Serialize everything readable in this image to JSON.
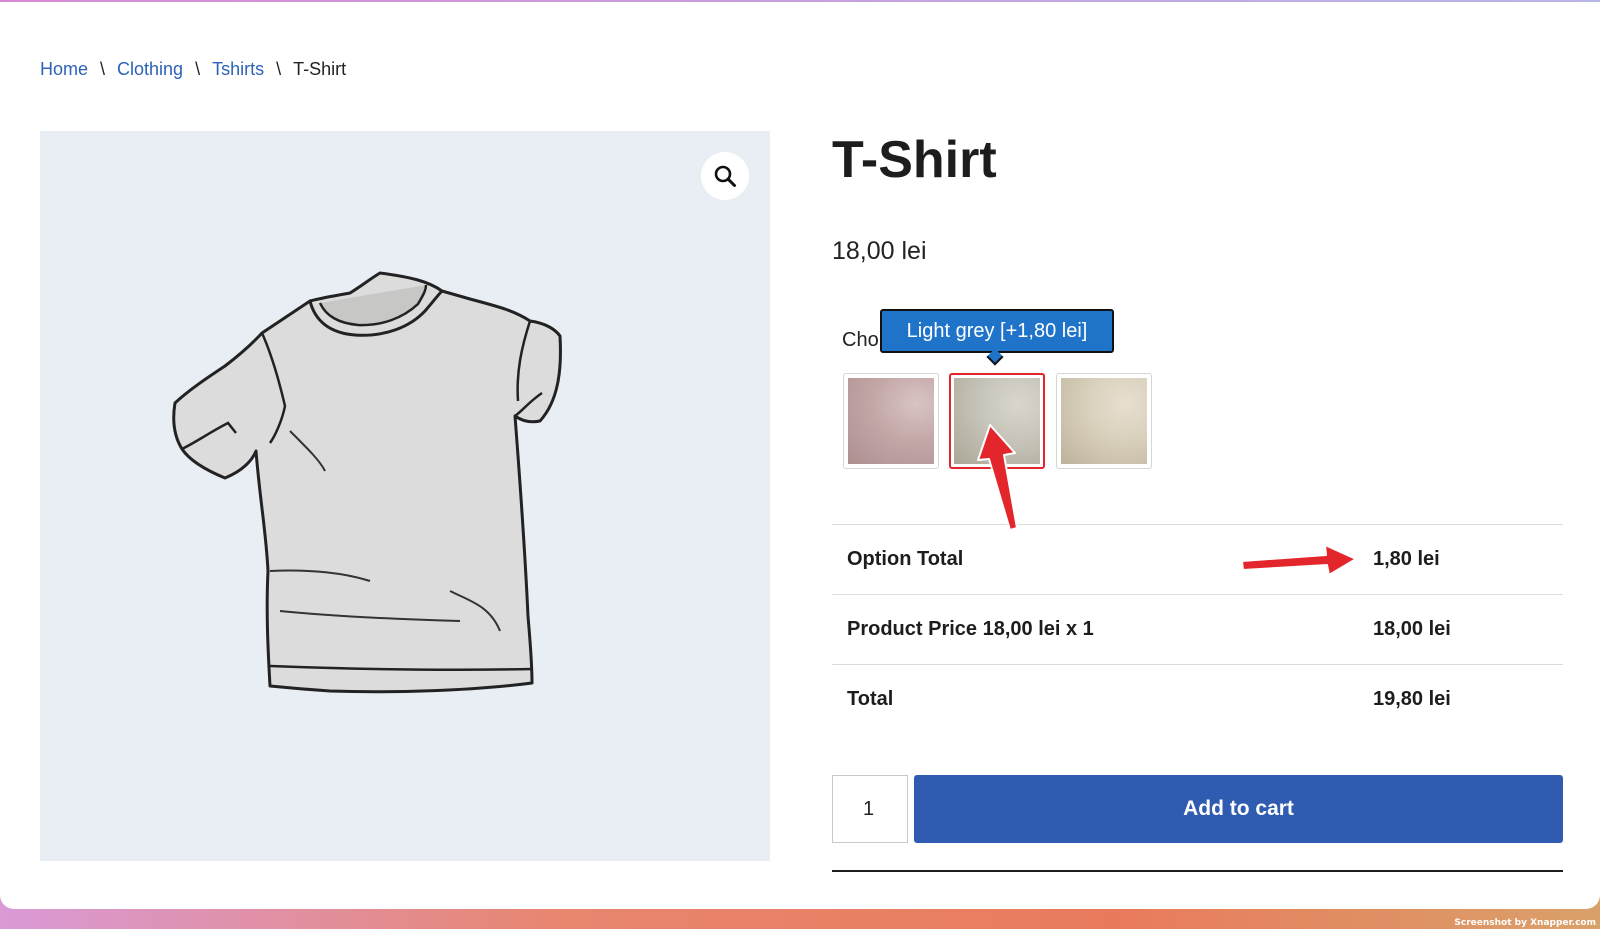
{
  "breadcrumb": {
    "items": [
      "Home",
      "Clothing",
      "Tshirts"
    ],
    "separator": "\\",
    "current": "T-Shirt"
  },
  "product": {
    "title": "T-Shirt",
    "price": "18,00 lei",
    "zoom_icon": "search-icon"
  },
  "options": {
    "label_visible": "Cho",
    "tooltip": "Light grey [+1,80 lei]",
    "swatches": [
      {
        "color": "#c3a7a7",
        "selected": false
      },
      {
        "color": "#c6c3b8",
        "selected": true
      },
      {
        "color": "#d8cfbb",
        "selected": false
      }
    ]
  },
  "totals": {
    "option_total_label": "Option Total",
    "option_total_value": "1,80 lei",
    "product_price_label": "Product Price 18,00 lei x 1",
    "product_price_value": "18,00 lei",
    "total_label": "Total",
    "total_value": "19,80 lei"
  },
  "cart": {
    "quantity": "1",
    "add_to_cart_label": "Add to cart"
  },
  "colors": {
    "link": "#2c63b6",
    "button": "#2f5bb0",
    "tooltip": "#1f74c9",
    "annotation": "#e3262c"
  },
  "watermark": "Screenshot by Xnapper.com"
}
